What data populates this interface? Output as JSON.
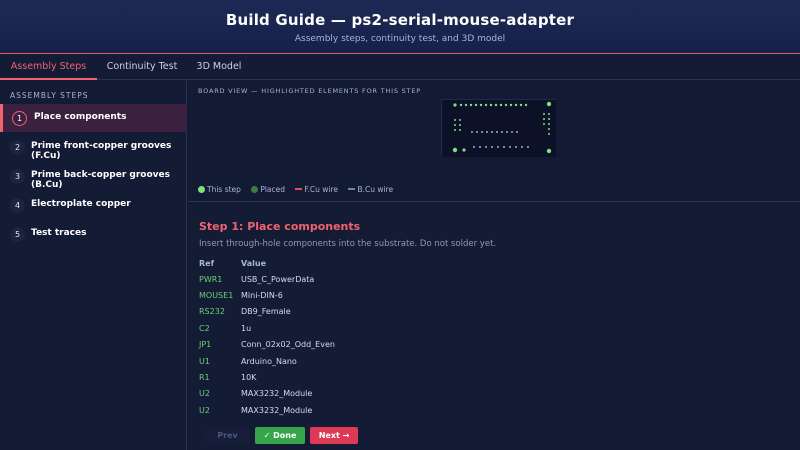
{
  "header": {
    "title": "Build Guide — ps2-serial-mouse-adapter",
    "subtitle": "Assembly steps, continuity test, and 3D model"
  },
  "tabs": [
    {
      "label": "Assembly Steps",
      "active": true
    },
    {
      "label": "Continuity Test",
      "active": false
    },
    {
      "label": "3D Model",
      "active": false
    }
  ],
  "sidebar": {
    "title": "ASSEMBLY STEPS",
    "steps": [
      {
        "num": "1",
        "label": "Place components",
        "active": true
      },
      {
        "num": "2",
        "label": "Prime front-copper grooves (F.Cu)",
        "active": false
      },
      {
        "num": "3",
        "label": "Prime back-copper grooves (B.Cu)",
        "active": false
      },
      {
        "num": "4",
        "label": "Electroplate copper",
        "active": false
      },
      {
        "num": "5",
        "label": "Test traces",
        "active": false
      }
    ]
  },
  "board_view": {
    "title": "BOARD VIEW — HIGHLIGHTED ELEMENTS FOR THIS STEP",
    "legend": [
      {
        "label": "This step",
        "kind": "dot",
        "color": "#7ee07a"
      },
      {
        "label": "Placed",
        "kind": "dot",
        "color": "#3d7a4a"
      },
      {
        "label": "F.Cu wire",
        "kind": "line",
        "color": "#e0505a"
      },
      {
        "label": "B.Cu wire",
        "kind": "line",
        "color": "#5a8ac0"
      }
    ]
  },
  "step_panel": {
    "title": "Step 1: Place components",
    "description": "Insert through-hole components into the substrate. Do not solder yet.",
    "col_ref": "Ref",
    "col_value": "Value",
    "rows": [
      {
        "ref": "PWR1",
        "value": "USB_C_PowerData"
      },
      {
        "ref": "MOUSE1",
        "value": "Mini-DIN-6"
      },
      {
        "ref": "RS232",
        "value": "DB9_Female"
      },
      {
        "ref": "C2",
        "value": "1u"
      },
      {
        "ref": "JP1",
        "value": "Conn_02x02_Odd_Even"
      },
      {
        "ref": "U1",
        "value": "Arduino_Nano"
      },
      {
        "ref": "R1",
        "value": "10K"
      },
      {
        "ref": "U2",
        "value": "MAX3232_Module"
      },
      {
        "ref": "U2",
        "value": "MAX3232_Module"
      }
    ]
  },
  "buttons": {
    "prev": "Prev",
    "done": "✓ Done",
    "next": "Next →"
  },
  "colors": {
    "accent": "#ef6470",
    "done": "#37a44a",
    "next": "#dd3a55",
    "ref_text": "#6fcf7a"
  }
}
